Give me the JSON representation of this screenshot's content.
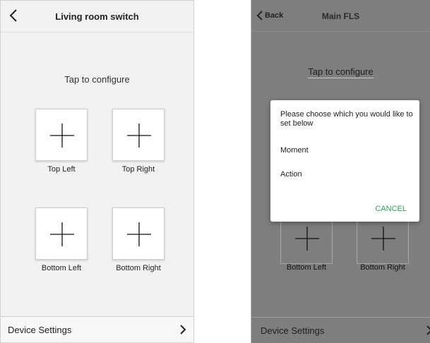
{
  "left_screen": {
    "title": "Living room switch",
    "instruction": "Tap to configure",
    "tiles": [
      {
        "label": "Top Left"
      },
      {
        "label": "Top Right"
      },
      {
        "label": "Bottom Left"
      },
      {
        "label": "Bottom Right"
      }
    ],
    "footer": {
      "label": "Device Settings"
    }
  },
  "right_screen": {
    "back_label": "Back",
    "title": "Main FLS",
    "instruction": "Tap to configure",
    "tiles": [
      {
        "label": "Bottom Left"
      },
      {
        "label": "Bottom Right"
      }
    ],
    "dialog": {
      "prompt": "Please choose which you would like to set below",
      "options": [
        "Moment",
        "Action"
      ],
      "cancel_label": "CANCEL",
      "cancel_color": "#2e9e57"
    },
    "footer": {
      "label": "Device Settings"
    }
  },
  "icons": {
    "back": "chevron-left-icon",
    "forward": "chevron-right-icon",
    "add": "plus-icon"
  }
}
